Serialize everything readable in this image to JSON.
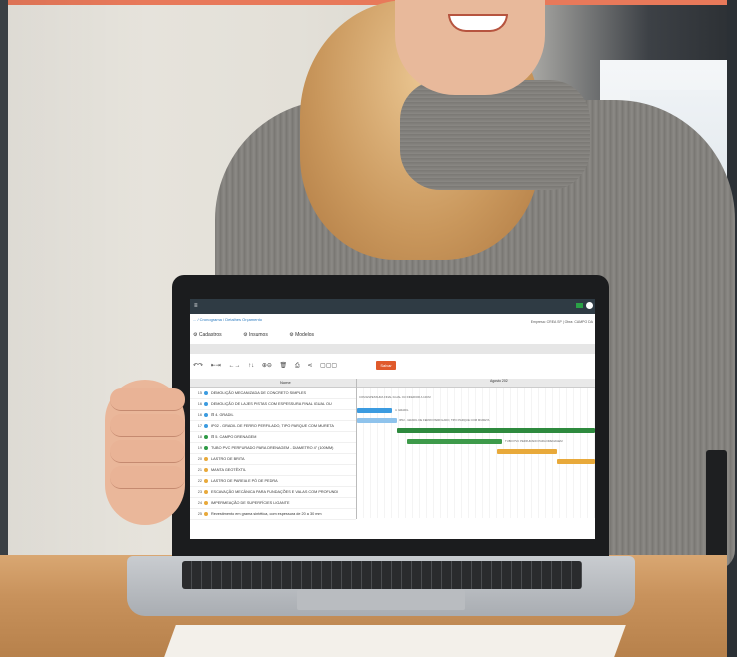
{
  "app": {
    "menu_icon": "≡",
    "breadcrumb": "... / Cronograma / Detalhes Orçamento",
    "company": "Empresa: CREA SP | Obra: CAMPO DA",
    "nav_tabs": [
      "Cadastros",
      "Insumos",
      "Modelos"
    ],
    "toolbar_icons": [
      "undo-icon",
      "redo-icon",
      "indent-icon",
      "move-arrows-icon",
      "up-down-icon",
      "zoom-in-icon",
      "zoom-out-icon",
      "trash-icon",
      "print-icon",
      "share-icon",
      "view-toggle-icon"
    ],
    "toolbar_glyphs": [
      "↶↷",
      "⇤⇥",
      "←→",
      "↑↓",
      "⊕⊖",
      "🗑",
      "⎙",
      "⋖",
      "▢▢▢"
    ],
    "save_label": "Salvar",
    "column_name": "Nome",
    "month_label": "Agosto 202",
    "rows": [
      {
        "num": "15",
        "dot": "#3b9be0",
        "name": "DEMOLIÇÃO MECANIZADA DE CONCRETO SIMPLES"
      },
      {
        "num": "16",
        "dot": "#3b9be0",
        "name": "DEMOLIÇÃO DE LAJES PISTAS COM ESPESSURA FINAL IGUAL OU"
      },
      {
        "num": "16",
        "dot": "#3b9be0",
        "name": "⊟ 4. GRADIL"
      },
      {
        "num": "17",
        "dot": "#3b9be0",
        "name": "IP02 - GRADIL DE FERRO PERFILADO, TIPO PARQUE COM MURETA"
      },
      {
        "num": "18",
        "dot": "#2e9a46",
        "name": "⊟ 5. CAMPO DRENAGEM"
      },
      {
        "num": "19",
        "dot": "#2e9a46",
        "name": "TUBO PVC PERFURADO PARA DRENAGEM - DIAMETRO 4\" (100MM)"
      },
      {
        "num": "20",
        "dot": "#e8a93a",
        "name": "LASTRO DE BRITA"
      },
      {
        "num": "21",
        "dot": "#e8a93a",
        "name": "MANTA GEOTÊXTIL"
      },
      {
        "num": "22",
        "dot": "#e8a93a",
        "name": "LASTRO DE PAREIA E PÓ DE PEDRA"
      },
      {
        "num": "23",
        "dot": "#e8a93a",
        "name": "ESCAVAÇÃO MECÂNICA PARA FUNDAÇÕES E VALAS COM PROFUNDI"
      },
      {
        "num": "24",
        "dot": "#e8a93a",
        "name": "IMPERMEAÇÃO DE SUPERFÍCIES LIGANTE"
      },
      {
        "num": "25",
        "dot": "#e8a93a",
        "name": "Revestimento em grama sintética, com espessura de 20 a 30 mm"
      }
    ],
    "gantt_labels": [
      "COM ESPESSURA FINAL IGUAL OU INFERIOR A 10CM",
      "4. GRADIL",
      "IP02 - GRADIL DE FERRO PERFILADO, TIPO PARQUE COM MURETA",
      "TUBO PVC PERFURADO PARA DRENAGEM"
    ]
  }
}
